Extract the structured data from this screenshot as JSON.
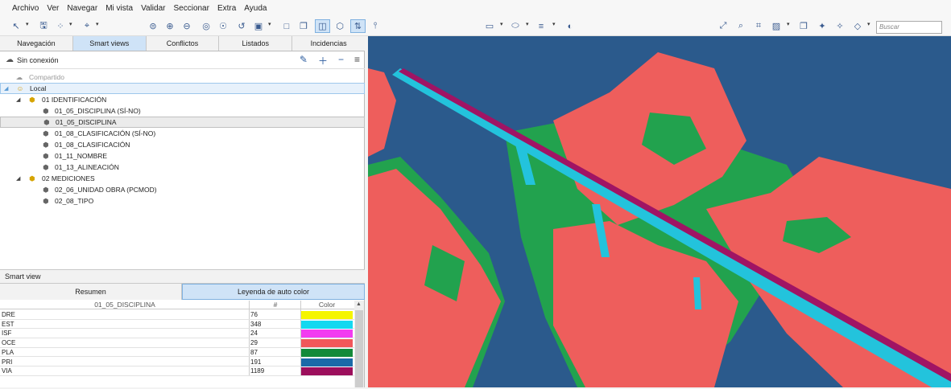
{
  "menu": [
    "Archivo",
    "Ver",
    "Navegar",
    "Mi vista",
    "Validar",
    "Seccionar",
    "Extra",
    "Ayuda"
  ],
  "toolbar": {
    "search_placeholder": "Buscar",
    "icons": [
      "select-icon",
      "save-icon",
      "walk-icon",
      "measure-icon",
      "zoom-fit-icon",
      "zoom-in-icon",
      "zoom-out-icon",
      "orbit-icon",
      "look-icon",
      "rotate-icon",
      "camera-icon",
      "sheet-icon",
      "copy-icon",
      "section-box-icon",
      "cube-icon",
      "sync-icon",
      "cut-plane-icon",
      "ruler-icon",
      "ellipse-icon",
      "lines-icon",
      "palette-icon",
      "fit-icon",
      "zoom-area-icon",
      "zoom-selection-icon",
      "views-icon",
      "bookmark-icon",
      "tag-icon",
      "hide-icon",
      "eraser-icon"
    ]
  },
  "left_tabs": [
    {
      "label": "Navegación",
      "active": false
    },
    {
      "label": "Smart views",
      "active": true
    },
    {
      "label": "Conflictos",
      "active": false
    },
    {
      "label": "Listados",
      "active": false
    },
    {
      "label": "Incidencias",
      "active": false
    }
  ],
  "connection": {
    "label": "Sin conexión",
    "actions": [
      "pencil-icon",
      "plus-icon",
      "minus-icon",
      "menu-icon"
    ]
  },
  "tree": [
    {
      "label": "Compartido",
      "muted": true
    },
    {
      "label": "Local",
      "selected": true
    },
    {
      "label": "01 IDENTIFICACIÓN"
    },
    {
      "label": "01_05_DISCIPLINA (SÍ-NO)"
    },
    {
      "label": "01_05_DISCIPLINA",
      "active": true
    },
    {
      "label": "01_08_CLASIFICACIÓN (SÍ-NO)"
    },
    {
      "label": "01_08_CLASIFICACIÓN"
    },
    {
      "label": "01_11_NOMBRE"
    },
    {
      "label": "01_13_ALINEACIÓN"
    },
    {
      "label": "02 MEDICIONES"
    },
    {
      "label": "02_06_UNIDAD OBRA (PCMOD)"
    },
    {
      "label": "02_08_TIPO"
    }
  ],
  "smart_view": {
    "title": "Smart view",
    "tabs": [
      {
        "label": "Resumen",
        "active": false
      },
      {
        "label": "Leyenda de auto color",
        "active": true
      }
    ],
    "columns": [
      "01_05_DISCIPLINA",
      "#",
      "Color"
    ],
    "rows": [
      {
        "name": "DRE",
        "count": "76",
        "color": "#f5f500"
      },
      {
        "name": "EST",
        "count": "348",
        "color": "#14d8f0"
      },
      {
        "name": "ISF",
        "count": "24",
        "color": "#f23cf0"
      },
      {
        "name": "OCE",
        "count": "29",
        "color": "#f1575a"
      },
      {
        "name": "PLA",
        "count": "87",
        "color": "#138a3a"
      },
      {
        "name": "PRI",
        "count": "191",
        "color": "#1a6aa8"
      },
      {
        "name": "VIA",
        "count": "1189",
        "color": "#9c0f5c"
      }
    ]
  },
  "viewport": {
    "background": "#2b5a8c",
    "terrain_color": "#ee5e5c",
    "vegetation_color": "#22a24e",
    "road_color": "#a01464",
    "edge_color": "#23c3dc"
  }
}
